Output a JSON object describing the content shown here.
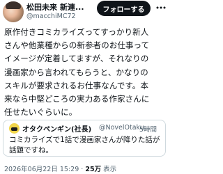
{
  "author": {
    "name_part1": "松田未来",
    "name_part2": "新連...",
    "handle": "@macchiMC72",
    "avatar_icon": "user-avatar-icon"
  },
  "follow_button": {
    "label": "フォローする"
  },
  "more_icon": "more-horizontal-icon",
  "tweet": {
    "lines": [
      "原作付きコミカライズってすっかり新人",
      "さんや他業種からの新参者のお仕事って",
      "イメージが定着してますが、それなりの",
      "漫画家から言われてもらうと、かなりの",
      "スキルが要求されるお仕事なんです。本",
      "来なら中堅どころの実力ある作家さんに",
      "任せたいぐらいに。"
    ]
  },
  "quoted": {
    "name": "オタクペンギン(社長)",
    "handle": "@NovelOtaku...",
    "separator": "·",
    "time": "5時間",
    "lines": [
      "コミカライズで1話で漫画家さんが降りた話が",
      "話題ですね。"
    ],
    "avatar_icon": "penguin-avatar-icon"
  },
  "meta": {
    "datetime": "2026年06月22日 15:29",
    "separator": "·",
    "views_count": "25万",
    "views_label": "表示"
  },
  "colors": {
    "text": "#0f1419",
    "secondary": "#536471",
    "border": "#cfd9de",
    "button_bg": "#0f1419"
  }
}
